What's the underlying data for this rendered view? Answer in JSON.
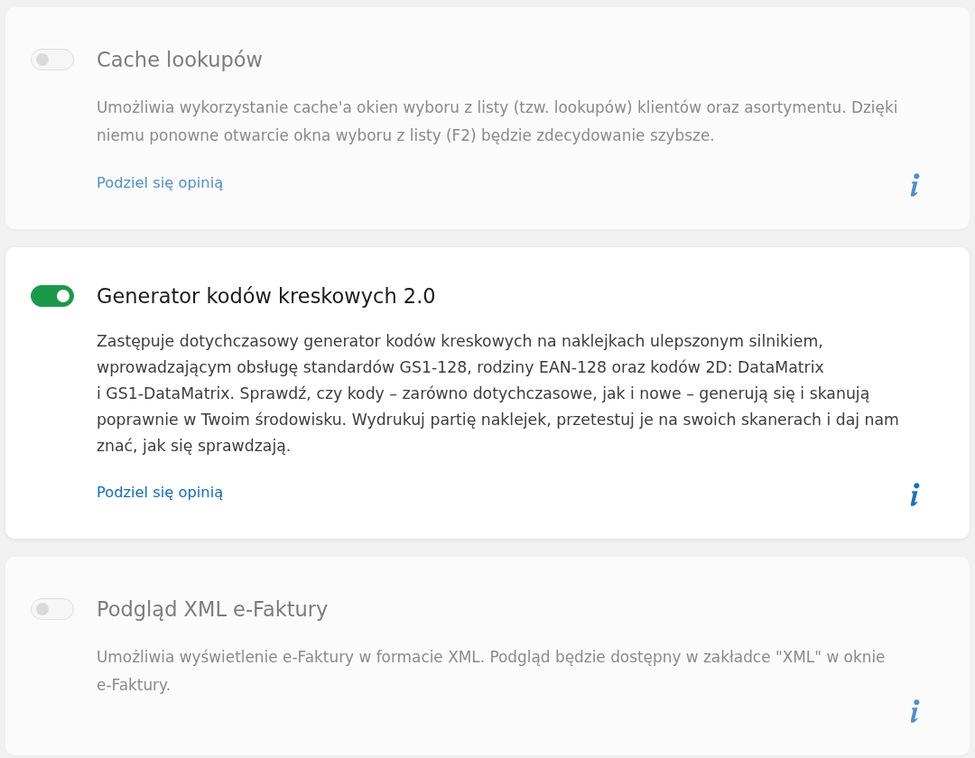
{
  "cards": [
    {
      "focused": false,
      "toggle": {
        "on": false
      },
      "title": "Cache lookupów",
      "description": "Umożliwia wykorzystanie cache'a okien wyboru z listy (tzw. lookupów) klientów oraz asortymentu. Dzięki niemu ponowne otwarcie okna wyboru z listy (F2) będzie zdecydowanie szybsze.",
      "feedback_link": "Podziel się opinią"
    },
    {
      "focused": true,
      "toggle": {
        "on": true
      },
      "title": "Generator kodów kreskowych 2.0",
      "description": "Zastępuje dotychczasowy generator kodów kreskowych na naklejkach ulepszonym silnikiem, wprowadzającym obsługę standardów GS1-128, rodziny EAN-128 oraz kodów 2D: DataMatrix i GS1-DataMatrix. Sprawdź, czy kody – zarówno dotychczasowe, jak i nowe – generują się i skanują poprawnie w Twoim środowisku. Wydrukuj partię naklejek, przetestuj je na swoich skanerach i daj nam znać, jak się sprawdzają.",
      "feedback_link": "Podziel się opinią"
    },
    {
      "focused": false,
      "toggle": {
        "on": false
      },
      "title": "Podgląd XML e-Faktury",
      "description": "Umożliwia wyświetlenie e-Faktury w formacie XML. Podgląd będzie dostępny w zakładce \"XML\" w oknie e-Faktury."
    }
  ]
}
